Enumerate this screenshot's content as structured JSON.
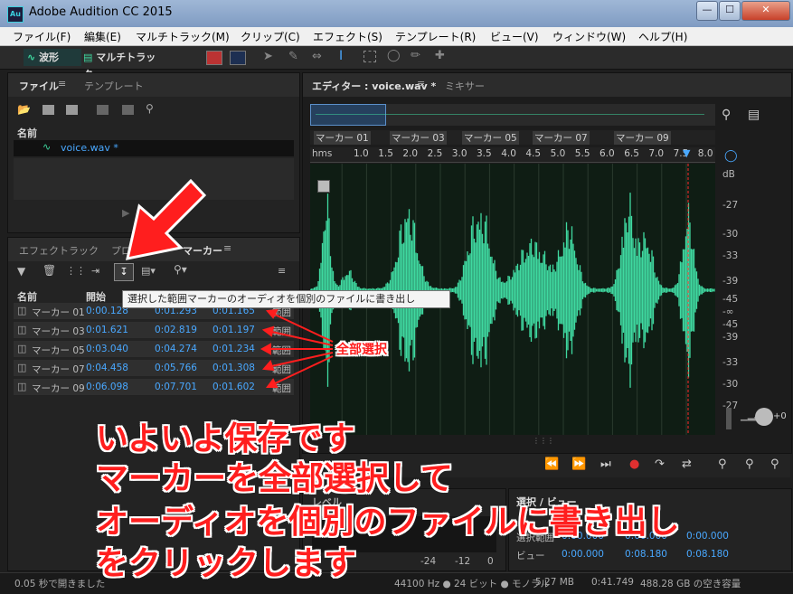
{
  "window": {
    "title": "Adobe Audition CC 2015",
    "icon_text": "Au",
    "controls": [
      "minimize",
      "maximize",
      "close"
    ]
  },
  "menu": [
    "ファイル(F)",
    "編集(E)",
    "マルチトラック(M)",
    "クリップ(C)",
    "エフェクト(S)",
    "テンプレート(R)",
    "ビュー(V)",
    "ウィンドウ(W)",
    "ヘルプ(H)"
  ],
  "toolbar": {
    "waveform_label": "波形",
    "multitrack_label": "マルチトラック"
  },
  "files_panel": {
    "tabs": [
      "ファイル",
      "テンプレート"
    ],
    "column_name": "名前",
    "file": "voice.wav *"
  },
  "markers_panel": {
    "tabs": [
      "エフェクトラック",
      "プロパ",
      "マーカー"
    ],
    "columns": [
      "名前",
      "開始"
    ],
    "tooltip": "選択した範囲マーカーのオーディオを個別のファイルに書き出し",
    "rows": [
      {
        "name": "マーカー 01",
        "start": "0:00.128",
        "end": "0:01.293",
        "duration": "0:01.165"
      },
      {
        "name": "マーカー 03",
        "start": "0:01.621",
        "end": "0:02.819",
        "duration": "0:01.197"
      },
      {
        "name": "マーカー 05",
        "start": "0:03.040",
        "end": "0:04.274",
        "duration": "0:01.234"
      },
      {
        "name": "マーカー 07",
        "start": "0:04.458",
        "end": "0:05.766",
        "duration": "0:01.308"
      },
      {
        "name": "マーカー 09",
        "start": "0:06.098",
        "end": "0:07.701",
        "duration": "0:01.602"
      }
    ],
    "range_label": "範囲"
  },
  "editor": {
    "tabs": [
      "エディター : voice.wav *",
      "ミキサー"
    ],
    "markers": [
      "マーカー 01",
      "マーカー 03",
      "マーカー 05",
      "マーカー 07",
      "マーカー 09"
    ],
    "ruler_unit": "hms",
    "ruler_ticks": [
      "1.0",
      "1.5",
      "2.0",
      "2.5",
      "3.0",
      "3.5",
      "4.0",
      "4.5",
      "5.0",
      "5.5",
      "6.0",
      "6.5",
      "7.0",
      "7.5",
      "8.0"
    ],
    "db_unit": "dB",
    "db_labels": [
      "-27",
      "-30",
      "-33",
      "-39",
      "-45",
      "-∞",
      "-45",
      "-39",
      "-33",
      "-30",
      "-27"
    ],
    "waveform_color": "#3fd9a0",
    "playhead_color": "#ff2a2a"
  },
  "bottom": {
    "level_label": "レベル",
    "level_ticks": [
      "-24",
      "-12",
      "0"
    ],
    "selection_title": "選択 / ビュー",
    "selection_rows": [
      {
        "label": "選択範囲",
        "start": "0:00.000",
        "end": "0:00.000",
        "duration": "0:00.000"
      },
      {
        "label": "ビュー",
        "start": "0:00.000",
        "end": "0:08.180",
        "duration": "0:08.180"
      }
    ]
  },
  "status": {
    "left": "0.05 秒で開きました",
    "sample": "44100 Hz ● 24 ビット ● モノラル",
    "size": "5.27 MB",
    "duration": "0:41.749",
    "free": "488.28 GB の空き容量"
  },
  "annotation": {
    "select_all": "全部選択",
    "line1": "いよいよ保存です",
    "line2": "マーカーを全部選択して",
    "line3": "オーディオを個別のファイルに書き出し",
    "line4": "をクリックします",
    "color": "#ff1e1e"
  }
}
